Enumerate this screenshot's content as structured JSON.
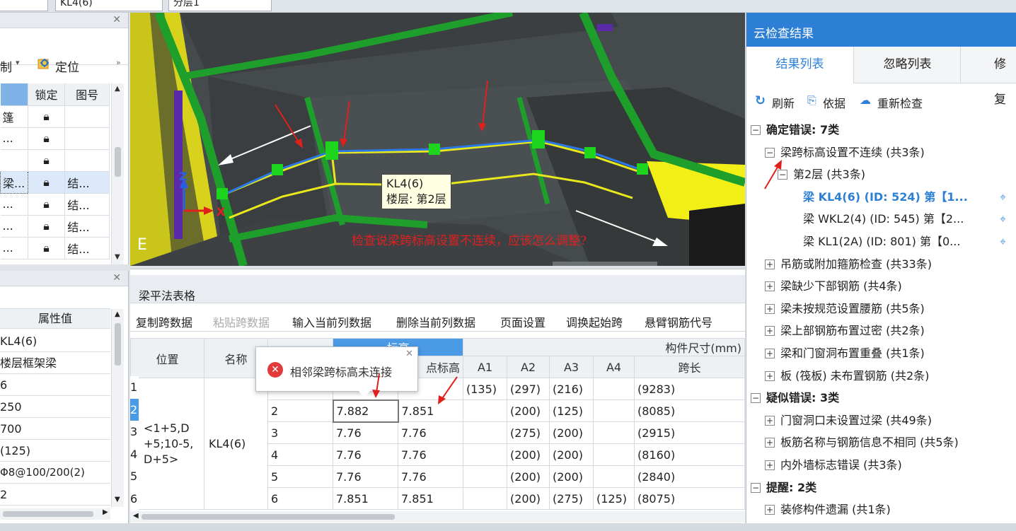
{
  "toolbar": {
    "combo_element": "KL4(6)",
    "combo_layer": "分层1",
    "combo_left": ""
  },
  "left_top": {
    "partial_label": "制",
    "locate_label": "定位",
    "col_lock": "锁定",
    "col_drawing": "图号",
    "rows": [
      {
        "name": "篷",
        "drawing": ""
      },
      {
        "name": "...",
        "drawing": ""
      },
      {
        "name": "",
        "drawing": ""
      },
      {
        "name": "梁...",
        "drawing": "结..."
      },
      {
        "name": "...",
        "drawing": "结..."
      },
      {
        "name": "...",
        "drawing": "结..."
      },
      {
        "name": "...",
        "drawing": "结..."
      }
    ]
  },
  "props": {
    "header": "属性值",
    "values": [
      "KL4(6)",
      "楼层框架梁",
      "6",
      "250",
      "700",
      "(125)",
      "Φ8@100/200(2)",
      "2"
    ]
  },
  "viewport": {
    "tooltip_line1": "KL4(6)",
    "tooltip_line2": "楼层: 第2层",
    "question": "检查说梁跨标高设置不连续，应该怎么调整?",
    "axis_z": "Z",
    "axis_x": "X",
    "compass": "E"
  },
  "table_panel": {
    "title": "梁平法表格",
    "buttons": [
      "复制跨数据",
      "粘贴跨数据",
      "输入当前列数据",
      "删除当前列数据",
      "页面设置",
      "调换起始跨",
      "悬臂钢筋代号"
    ],
    "col_position": "位置",
    "col_name": "名称",
    "col_elev": "标高",
    "col_end_elev": "点标高",
    "col_size": "构件尺寸(mm)",
    "col_a1": "A1",
    "col_a2": "A2",
    "col_a3": "A3",
    "col_a4": "A4",
    "col_span_len": "跨长",
    "position_value": "<1+5,D +5;10-5, D+5>",
    "name_value": "KL4(6)",
    "rows": [
      {
        "idx": "1",
        "span": "",
        "start": "",
        "end": "",
        "a1": "(135)",
        "a2": "(297)",
        "a3": "(216)",
        "a4": "",
        "len": "(9283)"
      },
      {
        "idx": "2",
        "span": "2",
        "start": "7.882",
        "end": "7.851",
        "a1": "",
        "a2": "(200)",
        "a3": "(125)",
        "a4": "",
        "len": "(8085)"
      },
      {
        "idx": "3",
        "span": "3",
        "start": "7.76",
        "end": "7.76",
        "a1": "",
        "a2": "(275)",
        "a3": "(200)",
        "a4": "",
        "len": "(2915)"
      },
      {
        "idx": "4",
        "span": "4",
        "start": "7.76",
        "end": "7.76",
        "a1": "",
        "a2": "(200)",
        "a3": "(200)",
        "a4": "",
        "len": "(8160)"
      },
      {
        "idx": "5",
        "span": "5",
        "start": "7.76",
        "end": "7.76",
        "a1": "",
        "a2": "(200)",
        "a3": "(200)",
        "a4": "",
        "len": "(2840)"
      },
      {
        "idx": "6",
        "span": "6",
        "start": "7.851",
        "end": "7.851",
        "a1": "",
        "a2": "(200)",
        "a3": "(275)",
        "a4": "(125)",
        "len": "(8075)"
      }
    ],
    "error_popup": "相邻梁跨标高未连接"
  },
  "right": {
    "title": "云检查结果",
    "tabs": [
      "结果列表",
      "忽略列表",
      "修复"
    ],
    "actions": {
      "refresh": "刷新",
      "basis": "依据",
      "recheck": "重新检查"
    },
    "tree": {
      "confirmed": "确定错误: 7类",
      "group1": "梁跨标高设置不连续 (共3条)",
      "floor": "第2层 (共3条)",
      "items": [
        "梁 KL4(6) (ID: 524) 第【1...",
        "梁 WKL2(4) (ID: 545) 第【2...",
        "梁 KL1(2A) (ID: 801) 第【0..."
      ],
      "confirmed_rest": [
        "吊筋或附加箍筋检查 (共33条)",
        "梁缺少下部钢筋 (共4条)",
        "梁未按规范设置腰筋 (共5条)",
        "梁上部钢筋布置过密 (共2条)",
        "梁和门窗洞布置重叠 (共1条)",
        "板 (筏板) 未布置钢筋 (共2条)"
      ],
      "suspected": "疑似错误: 3类",
      "suspected_items": [
        "门窗洞口未设置过梁 (共49条)",
        "板筋名称与钢筋信息不相同 (共5条)",
        "内外墙标志错误 (共3条)"
      ],
      "reminder": "提醒: 2类",
      "reminder_items": [
        "装修构件遗漏 (共1条)"
      ]
    }
  },
  "colors": {
    "accent": "#2d7fd6",
    "beam_green": "#1e9e2a",
    "beam_yellow": "#e8e81c",
    "arrow_red": "#e0201a",
    "error_red": "#e23b3b"
  }
}
